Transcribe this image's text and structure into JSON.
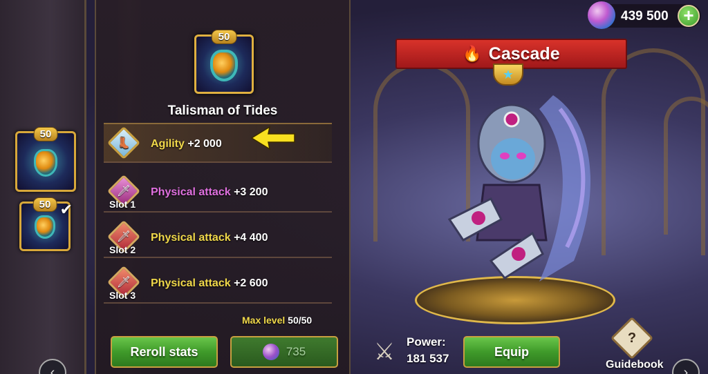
{
  "currency": {
    "amount": "439 500",
    "icon": "gem-icon",
    "add_icon": "plus-icon"
  },
  "left_strip": {
    "items": [
      {
        "level": "50",
        "icon": "talisman-icon",
        "equipped": false
      },
      {
        "level": "50",
        "icon": "talisman-icon",
        "equipped": true
      }
    ]
  },
  "item": {
    "level": "50",
    "name": "Talisman of Tides",
    "icon": "talisman-icon"
  },
  "stats": {
    "main": {
      "name": "Agility",
      "value": "+2 000",
      "icon": "agility-icon"
    },
    "slots": [
      {
        "slot_label": "Slot 1",
        "name": "Physical attack",
        "value": "+3 200",
        "color": "#e070e0"
      },
      {
        "slot_label": "Slot 2",
        "name": "Physical attack",
        "value": "+4 400",
        "color": "#f0d84a"
      },
      {
        "slot_label": "Slot 3",
        "name": "Physical attack",
        "value": "+2 600",
        "color": "#f0d84a"
      }
    ]
  },
  "max_level": {
    "label": "Max level",
    "value": "50/50"
  },
  "buttons": {
    "reroll": "Reroll stats",
    "cost": "735",
    "equip": "Equip"
  },
  "hero": {
    "name": "Cascade",
    "power_label": "Power:",
    "power_value": "181 537"
  },
  "guidebook": {
    "label": "Guidebook",
    "icon": "book-question-icon"
  },
  "colors": {
    "accent_green": "#3f9a2a",
    "gold": "#e0b040",
    "banner_red": "#d8322a",
    "stat_yellow": "#f0d84a",
    "stat_purple": "#e070e0"
  }
}
